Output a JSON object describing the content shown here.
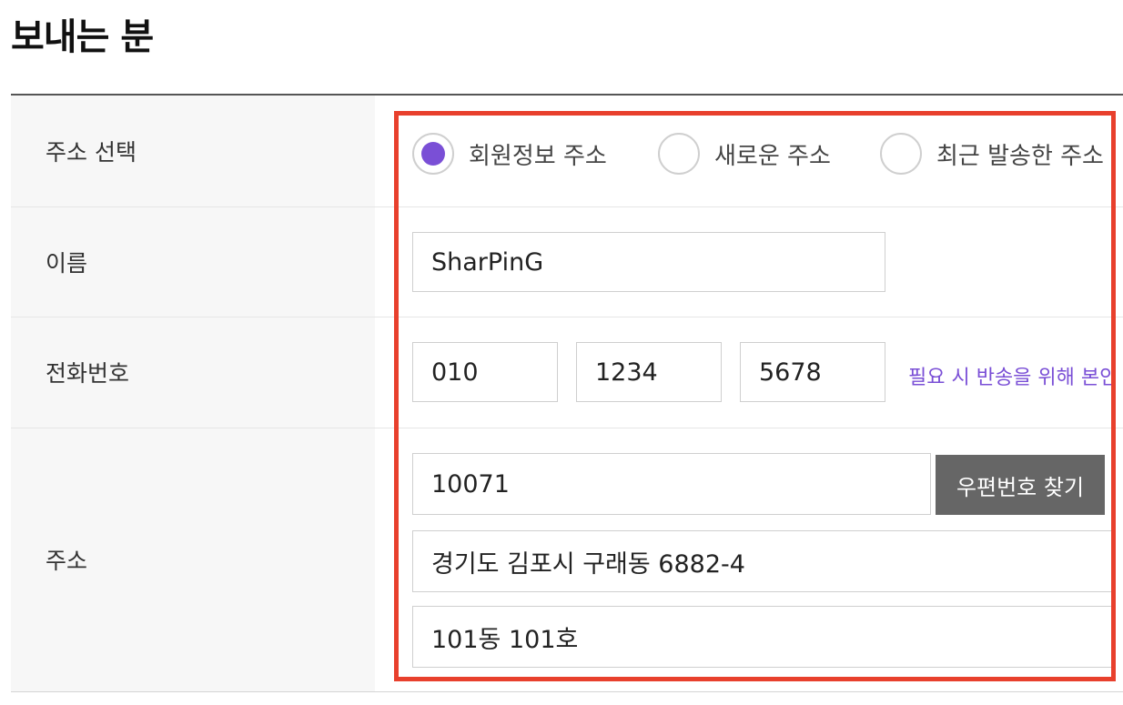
{
  "section_title": "보내는 분",
  "rows": {
    "address_select_label": "주소 선택",
    "name_label": "이름",
    "phone_label": "전화번호",
    "address_label": "주소"
  },
  "address_select": {
    "options": [
      {
        "label": "회원정보 주소",
        "checked": true
      },
      {
        "label": "새로운 주소",
        "checked": false
      },
      {
        "label": "최근 발송한 주소",
        "checked": false
      }
    ]
  },
  "name": {
    "value": "SharPinG"
  },
  "phone": {
    "part1": "010",
    "part2": "1234",
    "part3": "5678",
    "hint": "필요 시 반송을 위해 본인"
  },
  "address": {
    "zipcode": "10071",
    "zip_button": "우편번호 찾기",
    "line1": "경기도 김포시 구래동  6882-4",
    "line2": "101동 101호"
  },
  "colors": {
    "accent": "#7a4fd6",
    "highlight_border": "#e8402d",
    "button_bg": "#666666"
  }
}
